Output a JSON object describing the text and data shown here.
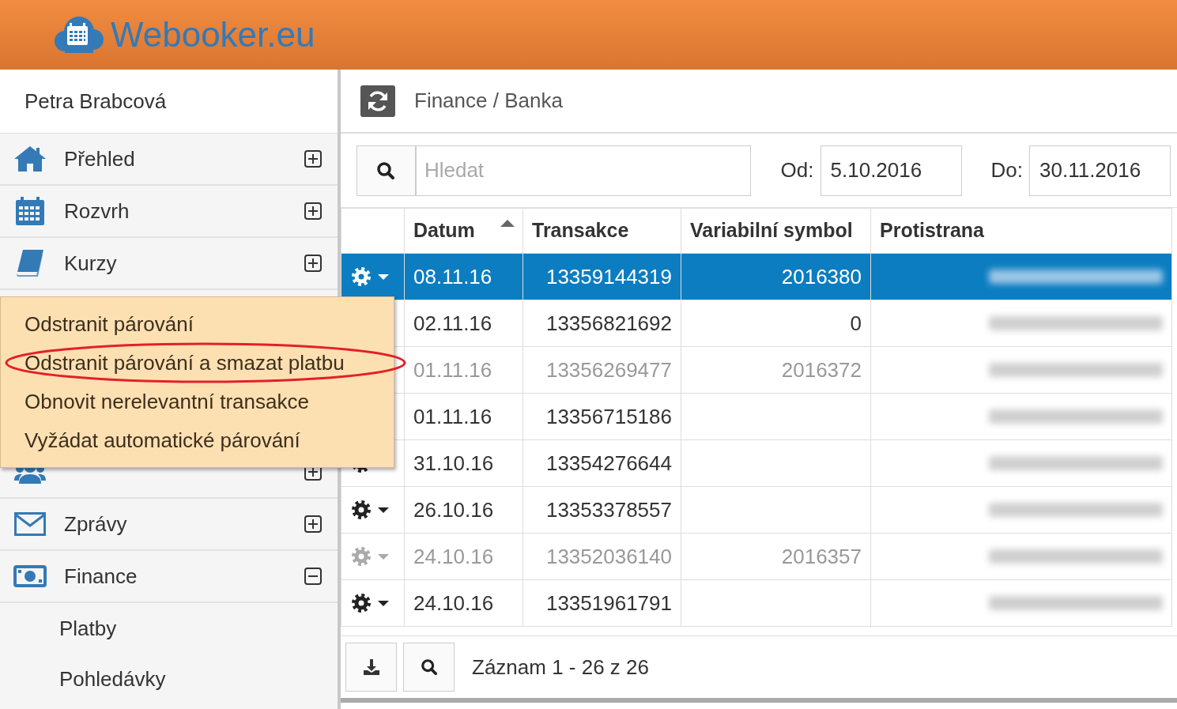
{
  "header": {
    "brand": "Webooker.eu"
  },
  "sidebar": {
    "user": "Petra Brabcová",
    "items": [
      {
        "label": "Přehled",
        "expanded": false
      },
      {
        "label": "Rozvrh",
        "expanded": false
      },
      {
        "label": "Kurzy",
        "expanded": false
      },
      {
        "expanded": false
      },
      {
        "label": "Zprávy",
        "expanded": false
      },
      {
        "label": "Finance",
        "expanded": true,
        "children": [
          {
            "label": "Platby"
          },
          {
            "label": "Pohledávky"
          }
        ]
      }
    ]
  },
  "page": {
    "title": "Finance / Banka"
  },
  "filters": {
    "search": {
      "placeholder": "Hledat"
    },
    "from": {
      "label": "Od:",
      "value": "5.10.2016"
    },
    "to": {
      "label": "Do:",
      "value": "30.11.2016"
    }
  },
  "table": {
    "columns": [
      {
        "label": "Datum",
        "sorted": true
      },
      {
        "label": "Transakce",
        "sorted": false
      },
      {
        "label": "Variabilní symbol",
        "sorted": false
      },
      {
        "label": "Protistrana",
        "sorted": false
      }
    ],
    "rows": [
      {
        "date": "08.11.16",
        "transaction": "13359144319",
        "variable_symbol": "2016380",
        "selected": true,
        "disabled": false
      },
      {
        "date": "02.11.16",
        "transaction": "13356821692",
        "variable_symbol": "0",
        "selected": false,
        "disabled": false
      },
      {
        "date": "01.11.16",
        "transaction": "13356269477",
        "variable_symbol": "2016372",
        "selected": false,
        "disabled": true
      },
      {
        "date": "01.11.16",
        "transaction": "13356715186",
        "selected": false,
        "disabled": false
      },
      {
        "date": "31.10.16",
        "transaction": "13354276644",
        "selected": false,
        "disabled": false
      },
      {
        "date": "26.10.16",
        "transaction": "13353378557",
        "selected": false,
        "disabled": false
      },
      {
        "date": "24.10.16",
        "transaction": "13352036140",
        "variable_symbol": "2016357",
        "selected": false,
        "disabled": true
      },
      {
        "date": "24.10.16",
        "transaction": "13351961791",
        "selected": false,
        "disabled": false
      }
    ]
  },
  "footer": {
    "record_count": "Záznam 1 - 26 z 26"
  },
  "context_menu": {
    "items": [
      {
        "label": "Odstranit párování",
        "circled": false
      },
      {
        "label": "Odstranit párování a smazat platbu",
        "circled": true
      },
      {
        "label": "Obnovit nerelevantní transakce",
        "circled": false
      },
      {
        "label": "Vyžádat automatické párování",
        "circled": false
      }
    ]
  }
}
